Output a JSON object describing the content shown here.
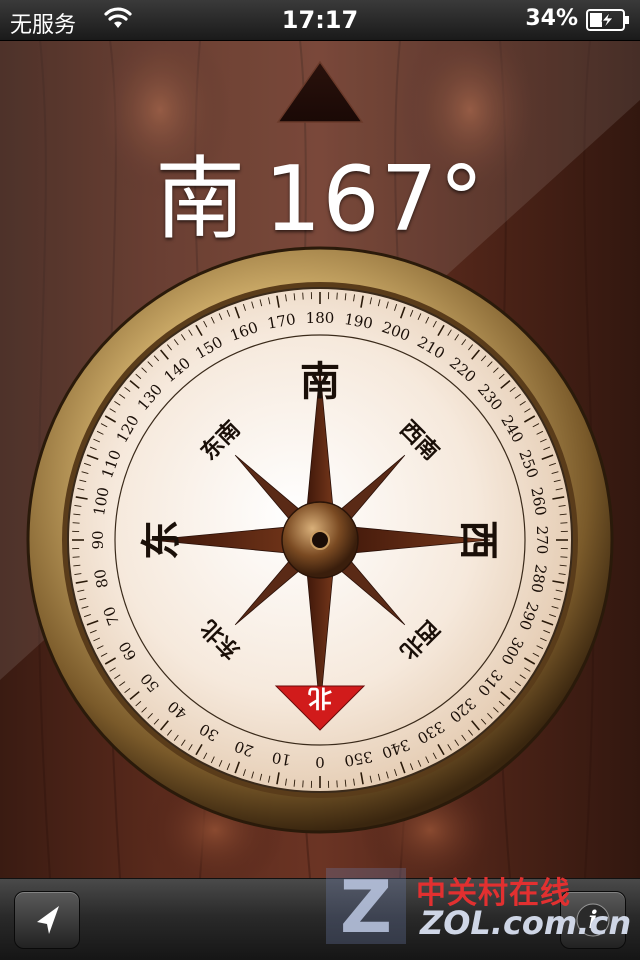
{
  "status_bar": {
    "carrier": "无服务",
    "time": "17:17",
    "battery_percent": "34%",
    "wifi_icon": "wifi-icon",
    "battery_icon": "battery-charging-icon"
  },
  "heading": {
    "direction": "南",
    "degrees": "167°"
  },
  "compass": {
    "cardinals": {
      "south": "南",
      "east": "东",
      "west": "西",
      "north": "北"
    },
    "intercardinals": {
      "southeast": "东南",
      "southwest": "西南",
      "northeast": "东北",
      "northwest": "西北"
    },
    "tick_labels": [
      "0",
      "10",
      "20",
      "30",
      "40",
      "50",
      "60",
      "70",
      "80",
      "90",
      "100",
      "110",
      "120",
      "130",
      "140",
      "150",
      "160",
      "170",
      "180",
      "190",
      "200",
      "210",
      "220",
      "230",
      "240",
      "250",
      "260",
      "270",
      "280",
      "290",
      "300",
      "310",
      "320",
      "330",
      "340",
      "350"
    ],
    "colors": {
      "north_marker": "#d11b1b",
      "dial": "#f6e9dc",
      "rim": "#8a6a3a"
    }
  },
  "toolbar": {
    "locate_icon": "location-arrow-icon",
    "info_icon": "info-icon",
    "info_label": "i"
  },
  "watermark": {
    "cn": "中关村在线",
    "en": "ZOL.com.cn",
    "logo": "Z"
  }
}
